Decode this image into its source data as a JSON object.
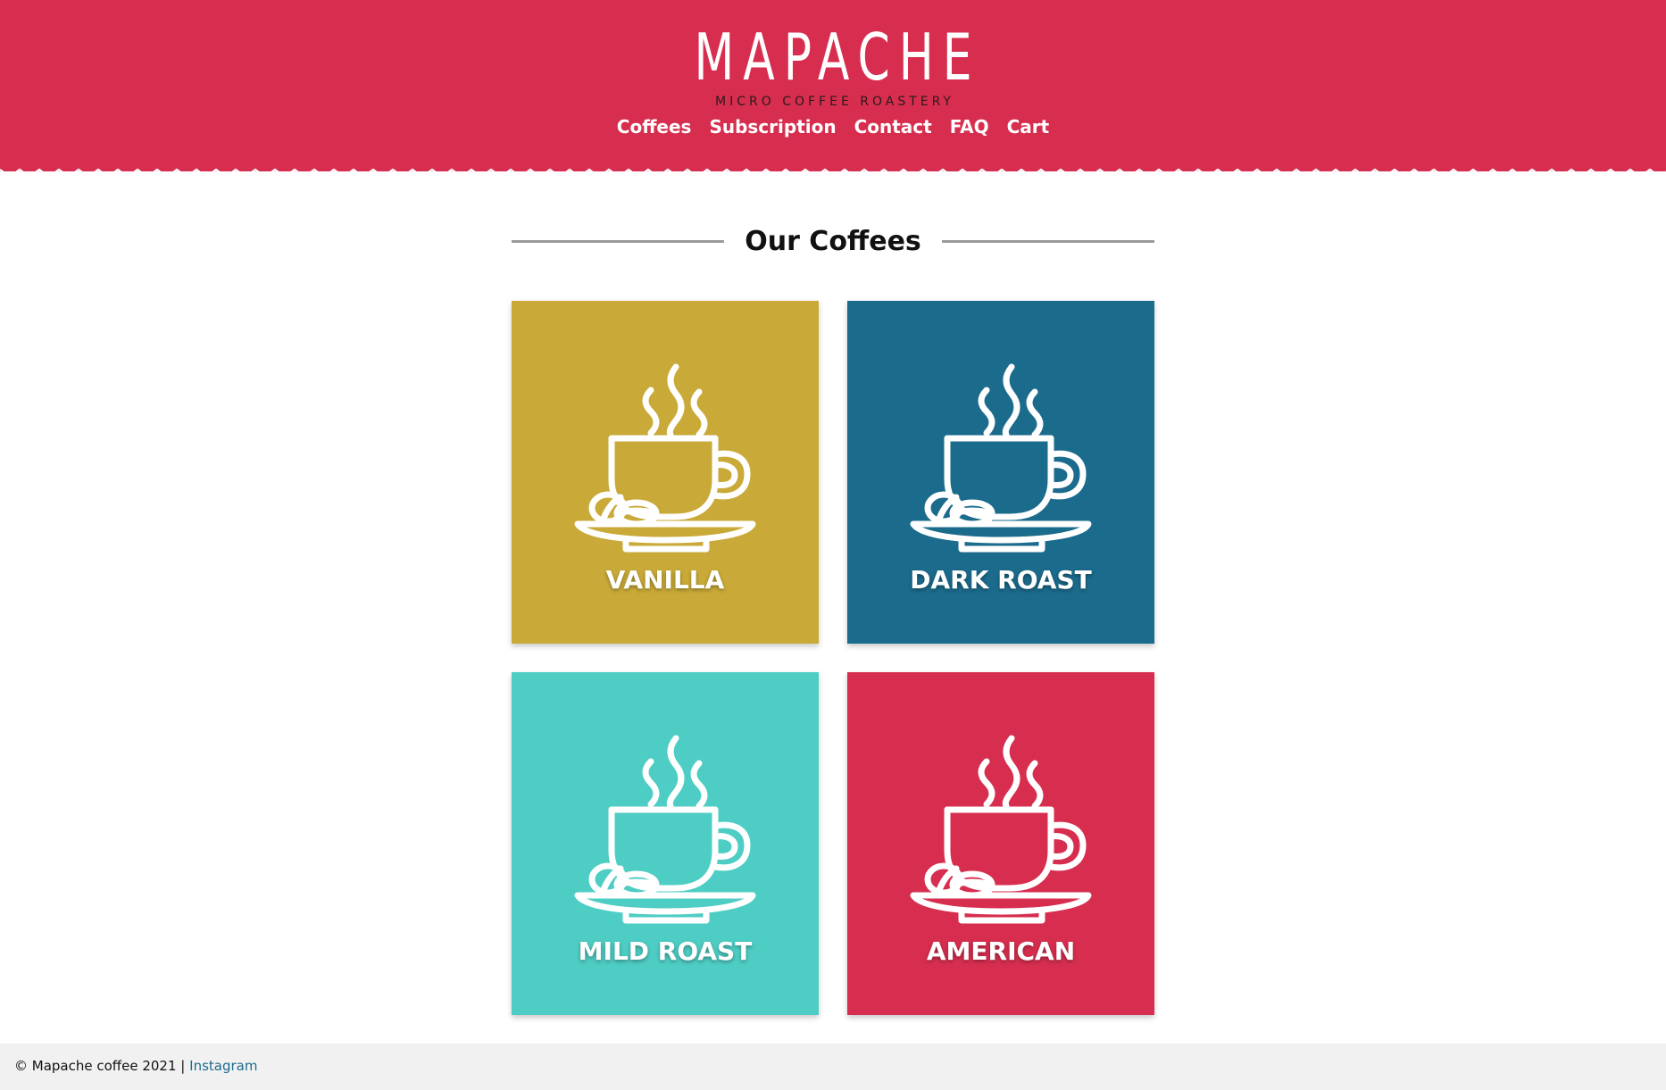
{
  "brand": {
    "name": "MAPACHE",
    "tagline": "MICRO COFFEE ROASTERY",
    "color": "#d72e4f"
  },
  "nav": {
    "items": [
      "Coffees",
      "Subscription",
      "Contact",
      "FAQ",
      "Cart"
    ]
  },
  "section": {
    "title": "Our Coffees"
  },
  "coffees": [
    {
      "label": "VANILLA",
      "color": "#c9aa38",
      "icon": "coffee-cup-icon"
    },
    {
      "label": "DARK ROAST",
      "color": "#1b6b8c",
      "icon": "coffee-cup-icon"
    },
    {
      "label": "MILD ROAST",
      "color": "#4ecdc4",
      "icon": "coffee-cup-icon"
    },
    {
      "label": "AMERICAN",
      "color": "#d72e4f",
      "icon": "coffee-cup-icon"
    }
  ],
  "footer": {
    "copyright": "© Mapache coffee 2021 |",
    "link": "Instagram"
  }
}
